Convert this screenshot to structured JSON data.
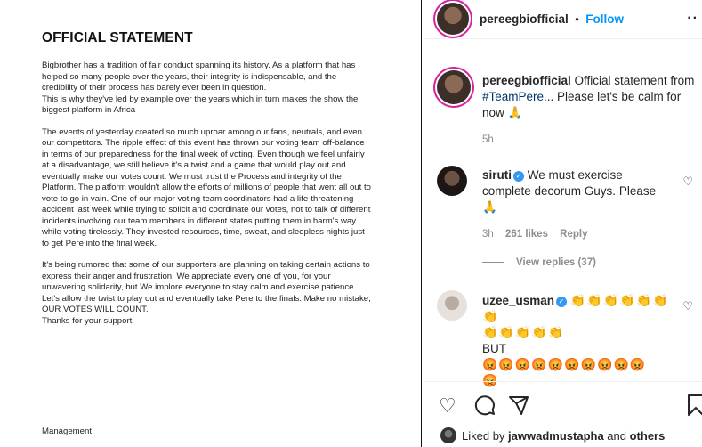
{
  "document": {
    "title": "OFFICIAL STATEMENT",
    "paragraphs": [
      "Bigbrother has a tradition of fair conduct spanning its history. As a platform that has helped so many people over the years, their integrity is indispensable, and the credibility of their process has barely ever been in question.\nThis is why they've led by example over the years which in turn makes the show the biggest platform in Africa",
      "The events of yesterday created so much uproar among our fans, neutrals, and even our competitors. The ripple effect of this event has thrown our voting team off-balance in terms of our preparedness for the final week of voting. Even though we feel unfairly at a disadvantage, we still believe it's a twist and a game that would play out and eventually make our votes count. We must trust the Process and integrity of the Platform. The platform wouldn't allow the efforts of millions of people that went all out to vote to go in vain. One of our major voting team coordinators had a life-threatening accident last week while trying to solicit and coordinate our votes, not to talk of different incidents involving our team members in different states putting them in harm's way while voting tirelessly. They invested resources, time, sweat, and sleepless nights just to get Pere into the final week.",
      "It's being rumored that some of our supporters are planning on taking certain actions to express their anger and frustration. We appreciate every one of you, for your unwavering solidarity, but We implore everyone to stay calm and exercise patience. Let's allow the twist to play out and eventually take Pere to the finals. Make no mistake, OUR VOTES WILL COUNT.\nThanks for your support"
    ],
    "signature": "Management"
  },
  "header": {
    "username": "pereegbiofficial",
    "separator": "•",
    "follow_label": "Follow",
    "more_icon": "more-horizontal-icon"
  },
  "caption": {
    "username": "pereegbiofficial",
    "text": " Official statement from ",
    "hashtag": "#TeamPere",
    "text_after": "... Please let's be calm for now 🙏",
    "time": "5h"
  },
  "comments": [
    {
      "username": "siruti",
      "text": " We must exercise complete decorum Guys. Please 🙏",
      "time": "3h",
      "likes": "261 likes",
      "reply_label": "Reply",
      "view_replies": "View replies (37)"
    },
    {
      "username": "uzee_usman",
      "line1": "👏👏👏👏👏👏👏",
      "line2": "👏👏👏👏👏",
      "line3": "BUT",
      "line4": "😡😡😡😡😡😡😡😡😡😡",
      "line5": "😡"
    }
  ],
  "liked_by": {
    "prefix": "Liked by ",
    "user": "jawwadmustapha",
    "middle": " and ",
    "others": "others"
  },
  "colors": {
    "link_blue": "#0095f6",
    "verified_blue": "#3897f0",
    "ring": "#d6249f"
  }
}
